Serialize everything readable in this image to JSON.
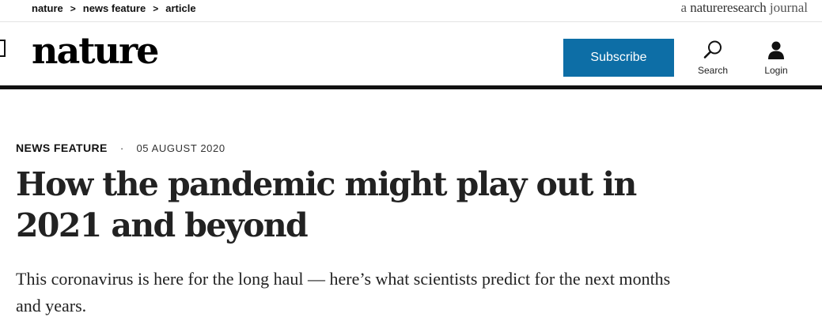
{
  "breadcrumb": {
    "items": [
      "nature",
      "news feature",
      "article"
    ],
    "separator": ">"
  },
  "tagline": {
    "prefix": "a ",
    "brand": "natureresearch",
    "suffix": " journal"
  },
  "header": {
    "logo": "nature",
    "subscribe_label": "Subscribe",
    "search_label": "Search",
    "login_label": "Login",
    "accent_color": "#0d6ea6"
  },
  "article": {
    "type": "NEWS FEATURE",
    "separator": "·",
    "date": "05 AUGUST 2020",
    "title": "How the pandemic might play out in 2021 and beyond",
    "standfirst": "This coronavirus is here for the long haul — here’s what scientists predict for the next months and years."
  }
}
